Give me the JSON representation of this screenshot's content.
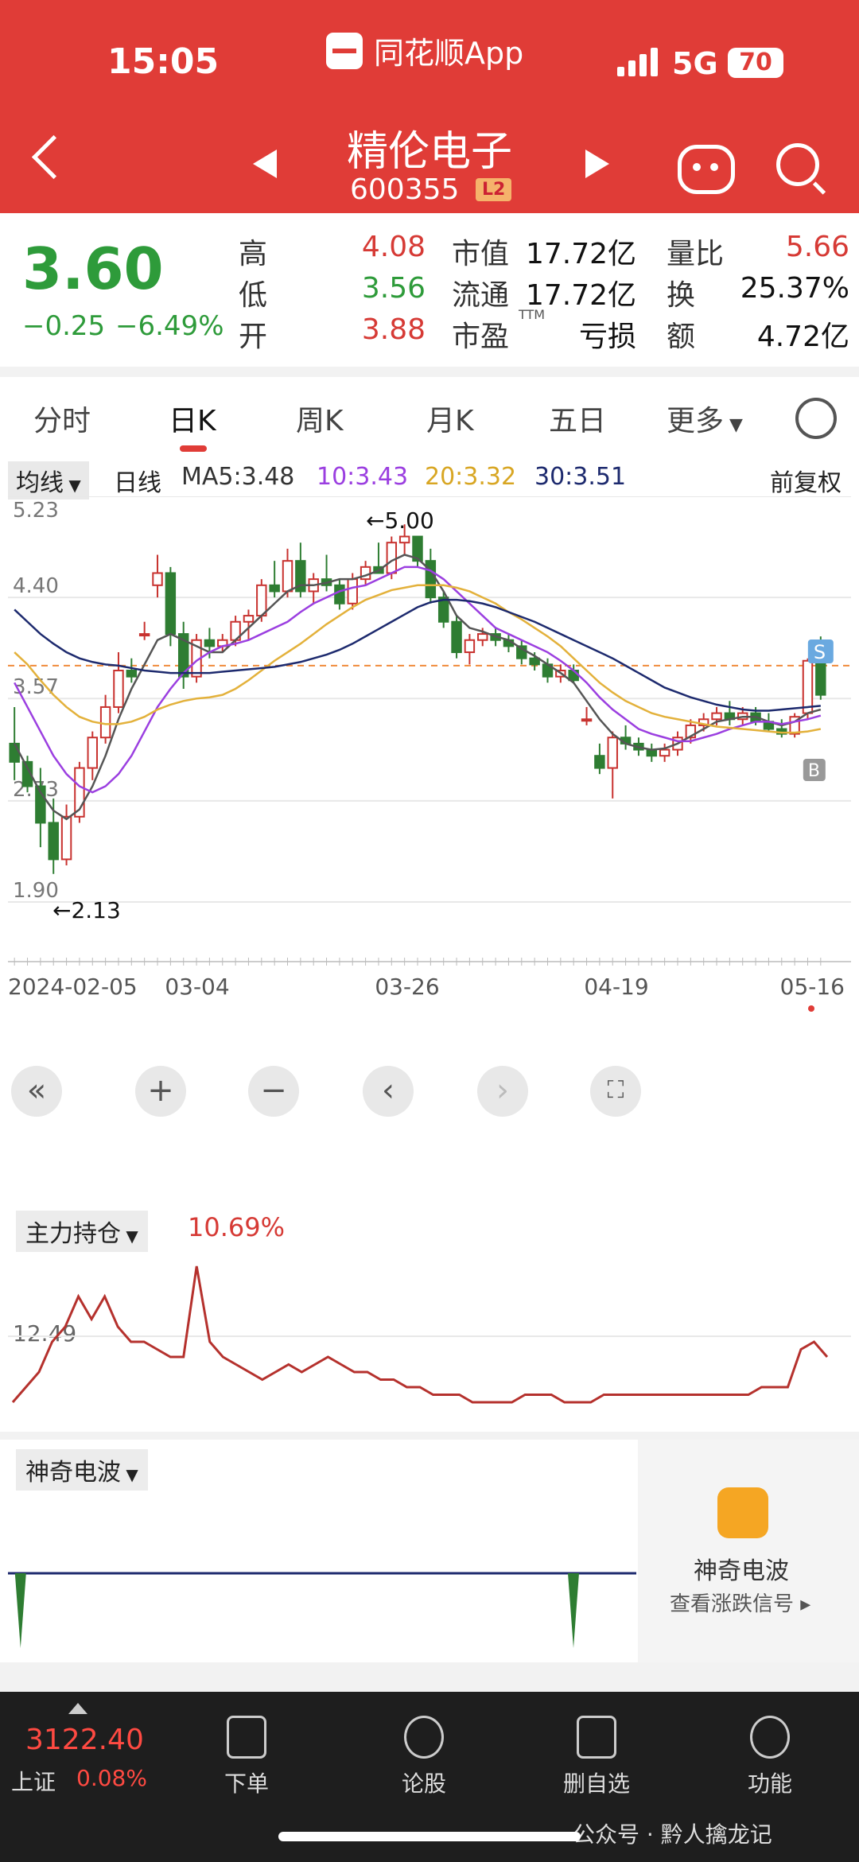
{
  "status_bar": {
    "time": "15:05",
    "app_name": "同花顺App",
    "network": "5G",
    "battery": "70"
  },
  "header": {
    "stock_name": "精伦电子",
    "stock_code": "600355",
    "level_badge": "L2"
  },
  "quote": {
    "price": "3.60",
    "change": "−0.25",
    "change_pct": "−6.49%",
    "rows": [
      {
        "l1": "高",
        "v1": "4.08",
        "l2": "市值",
        "v2": "17.72亿",
        "l3": "量比",
        "v3": "5.66"
      },
      {
        "l1": "低",
        "v1": "3.56",
        "l2": "流通",
        "v2": "17.72亿",
        "l3": "换",
        "v3": "25.37%"
      },
      {
        "l1": "开",
        "v1": "3.88",
        "l2": "市盈",
        "v2": "亏损",
        "l3": "额",
        "v3": "4.72亿"
      }
    ],
    "ttm": "TTM"
  },
  "tabs": [
    "分时",
    "日K",
    "周K",
    "月K",
    "五日",
    "更多"
  ],
  "ma_bar": {
    "selector": "均线",
    "period": "日线",
    "ma5": "MA5:3.48",
    "ma10": "10:3.43",
    "ma20": "20:3.32",
    "ma30": "30:3.51",
    "adjust": "前复权"
  },
  "colors": {
    "up": "#c8322f",
    "down": "#2e7d32",
    "ma5": "#555555",
    "ma10": "#9b3fe0",
    "ma20": "#e3b13b",
    "ma30": "#1d2a6e",
    "accent": "#e03c37"
  },
  "chart_data": {
    "type": "candlestick",
    "y_ticks": [
      "5.23",
      "4.40",
      "3.57",
      "2.73",
      "1.90"
    ],
    "ylim": [
      1.9,
      5.23
    ],
    "x_ticks": [
      "2024-02-05",
      "03-04",
      "03-26",
      "04-19",
      "05-16"
    ],
    "annotations": {
      "high": "←5.00",
      "low": "←2.13",
      "sell_marker": "S",
      "buy_marker": "B"
    },
    "reference_price": 3.84,
    "candles": [
      [
        3.2,
        3.5,
        2.9,
        3.05
      ],
      [
        3.05,
        3.1,
        2.8,
        2.85
      ],
      [
        2.85,
        3.0,
        2.35,
        2.55
      ],
      [
        2.55,
        2.75,
        2.13,
        2.25
      ],
      [
        2.25,
        2.7,
        2.2,
        2.6
      ],
      [
        2.6,
        3.05,
        2.55,
        3.0
      ],
      [
        3.0,
        3.3,
        2.9,
        3.25
      ],
      [
        3.25,
        3.6,
        3.2,
        3.5
      ],
      [
        3.5,
        3.95,
        3.45,
        3.8
      ],
      [
        3.8,
        3.9,
        3.7,
        3.75
      ],
      [
        4.1,
        4.2,
        4.05,
        4.1
      ],
      [
        4.5,
        4.75,
        4.4,
        4.6
      ],
      [
        4.6,
        4.65,
        4.0,
        4.1
      ],
      [
        4.1,
        4.2,
        3.65,
        3.75
      ],
      [
        3.75,
        4.1,
        3.7,
        4.05
      ],
      [
        4.05,
        4.15,
        3.9,
        4.0
      ],
      [
        4.0,
        4.1,
        3.95,
        4.05
      ],
      [
        4.05,
        4.25,
        4.0,
        4.2
      ],
      [
        4.2,
        4.3,
        4.05,
        4.25
      ],
      [
        4.25,
        4.55,
        4.2,
        4.5
      ],
      [
        4.5,
        4.7,
        4.4,
        4.45
      ],
      [
        4.45,
        4.8,
        4.4,
        4.7
      ],
      [
        4.7,
        4.85,
        4.4,
        4.45
      ],
      [
        4.45,
        4.6,
        4.35,
        4.55
      ],
      [
        4.55,
        4.75,
        4.45,
        4.5
      ],
      [
        4.5,
        4.55,
        4.3,
        4.35
      ],
      [
        4.35,
        4.6,
        4.3,
        4.55
      ],
      [
        4.55,
        4.7,
        4.5,
        4.65
      ],
      [
        4.65,
        4.85,
        4.6,
        4.6
      ],
      [
        4.6,
        4.9,
        4.55,
        4.85
      ],
      [
        4.85,
        5.0,
        4.75,
        4.9
      ],
      [
        4.9,
        4.9,
        4.65,
        4.7
      ],
      [
        4.7,
        4.8,
        4.35,
        4.4
      ],
      [
        4.4,
        4.45,
        4.15,
        4.2
      ],
      [
        4.2,
        4.25,
        3.9,
        3.95
      ],
      [
        3.95,
        4.1,
        3.85,
        4.05
      ],
      [
        4.05,
        4.15,
        4.0,
        4.1
      ],
      [
        4.1,
        4.15,
        4.0,
        4.05
      ],
      [
        4.05,
        4.1,
        3.95,
        4.0
      ],
      [
        4.0,
        4.05,
        3.85,
        3.9
      ],
      [
        3.9,
        3.95,
        3.8,
        3.85
      ],
      [
        3.85,
        3.9,
        3.7,
        3.75
      ],
      [
        3.75,
        3.85,
        3.7,
        3.8
      ],
      [
        3.8,
        3.85,
        3.7,
        3.72
      ],
      [
        3.4,
        3.5,
        3.35,
        3.4
      ],
      [
        3.1,
        3.2,
        2.95,
        3.0
      ],
      [
        3.0,
        3.3,
        2.75,
        3.25
      ],
      [
        3.25,
        3.35,
        3.15,
        3.2
      ],
      [
        3.2,
        3.25,
        3.1,
        3.15
      ],
      [
        3.15,
        3.2,
        3.05,
        3.1
      ],
      [
        3.1,
        3.2,
        3.05,
        3.15
      ],
      [
        3.15,
        3.3,
        3.1,
        3.25
      ],
      [
        3.25,
        3.4,
        3.2,
        3.35
      ],
      [
        3.35,
        3.45,
        3.3,
        3.4
      ],
      [
        3.4,
        3.5,
        3.35,
        3.45
      ],
      [
        3.45,
        3.55,
        3.35,
        3.4
      ],
      [
        3.4,
        3.5,
        3.35,
        3.45
      ],
      [
        3.45,
        3.5,
        3.35,
        3.38
      ],
      [
        3.38,
        3.45,
        3.3,
        3.32
      ],
      [
        3.32,
        3.4,
        3.25,
        3.28
      ],
      [
        3.28,
        3.45,
        3.25,
        3.42
      ],
      [
        3.45,
        3.9,
        3.4,
        3.88
      ],
      [
        3.88,
        4.08,
        3.56,
        3.6
      ]
    ],
    "ma5": [
      3.2,
      3.0,
      2.8,
      2.65,
      2.58,
      2.66,
      2.85,
      3.1,
      3.4,
      3.65,
      3.85,
      4.05,
      4.1,
      4.05,
      4.0,
      3.95,
      3.95,
      4.05,
      4.15,
      4.25,
      4.35,
      4.45,
      4.5,
      4.5,
      4.52,
      4.55,
      4.55,
      4.58,
      4.62,
      4.7,
      4.75,
      4.72,
      4.62,
      4.45,
      4.25,
      4.15,
      4.12,
      4.08,
      4.05,
      3.98,
      3.92,
      3.85,
      3.78,
      3.7,
      3.55,
      3.4,
      3.28,
      3.2,
      3.17,
      3.15,
      3.16,
      3.2,
      3.26,
      3.32,
      3.38,
      3.4,
      3.42,
      3.42,
      3.38,
      3.35,
      3.38,
      3.45,
      3.48
    ],
    "ma10": [
      3.7,
      3.5,
      3.3,
      3.1,
      2.95,
      2.85,
      2.8,
      2.85,
      2.95,
      3.1,
      3.3,
      3.5,
      3.65,
      3.78,
      3.88,
      3.95,
      4.0,
      4.02,
      4.05,
      4.1,
      4.15,
      4.2,
      4.28,
      4.35,
      4.4,
      4.45,
      4.48,
      4.5,
      4.55,
      4.6,
      4.65,
      4.65,
      4.62,
      4.55,
      4.45,
      4.35,
      4.25,
      4.15,
      4.1,
      4.05,
      4.0,
      3.95,
      3.88,
      3.8,
      3.7,
      3.58,
      3.48,
      3.4,
      3.32,
      3.28,
      3.25,
      3.22,
      3.22,
      3.25,
      3.28,
      3.32,
      3.35,
      3.38,
      3.38,
      3.36,
      3.38,
      3.4,
      3.43
    ],
    "ma20": [
      3.95,
      3.85,
      3.72,
      3.6,
      3.5,
      3.42,
      3.38,
      3.36,
      3.36,
      3.38,
      3.42,
      3.48,
      3.52,
      3.55,
      3.57,
      3.58,
      3.6,
      3.65,
      3.72,
      3.8,
      3.88,
      3.95,
      4.02,
      4.1,
      4.18,
      4.25,
      4.32,
      4.38,
      4.42,
      4.46,
      4.48,
      4.5,
      4.5,
      4.5,
      4.48,
      4.45,
      4.4,
      4.35,
      4.28,
      4.22,
      4.15,
      4.08,
      4.0,
      3.9,
      3.8,
      3.7,
      3.62,
      3.55,
      3.5,
      3.45,
      3.42,
      3.4,
      3.38,
      3.36,
      3.34,
      3.33,
      3.32,
      3.31,
      3.3,
      3.29,
      3.29,
      3.3,
      3.32
    ],
    "ma30": [
      4.3,
      4.2,
      4.1,
      4.02,
      3.95,
      3.9,
      3.87,
      3.85,
      3.84,
      3.82,
      3.8,
      3.79,
      3.78,
      3.78,
      3.78,
      3.78,
      3.79,
      3.8,
      3.81,
      3.82,
      3.83,
      3.85,
      3.87,
      3.9,
      3.93,
      3.97,
      4.02,
      4.08,
      4.14,
      4.2,
      4.26,
      4.32,
      4.36,
      4.38,
      4.38,
      4.37,
      4.35,
      4.32,
      4.28,
      4.24,
      4.2,
      4.15,
      4.1,
      4.05,
      4.0,
      3.95,
      3.9,
      3.84,
      3.78,
      3.72,
      3.66,
      3.62,
      3.58,
      3.55,
      3.52,
      3.5,
      3.48,
      3.47,
      3.47,
      3.48,
      3.49,
      3.5,
      3.51
    ]
  },
  "indicator1": {
    "selector": "主力持仓",
    "value": "10.69%",
    "y_tick": "12.49",
    "values": [
      2,
      4,
      6,
      10,
      12,
      16,
      13,
      16,
      12,
      10,
      10,
      9,
      8,
      8,
      20,
      10,
      8,
      7,
      6,
      5,
      6,
      7,
      6,
      7,
      8,
      7,
      6,
      6,
      5,
      5,
      4,
      4,
      3,
      3,
      3,
      2,
      2,
      2,
      2,
      3,
      3,
      3,
      2,
      2,
      2,
      3,
      3,
      3,
      3,
      3,
      3,
      3,
      3,
      3,
      3,
      3,
      3,
      4,
      4,
      4,
      9,
      10,
      8
    ]
  },
  "indicator2": {
    "selector": "神奇电波",
    "promo_title": "神奇电波",
    "promo_sub": "查看涨跌信号",
    "spikes": [
      0.02,
      0.9
    ]
  },
  "bottom": {
    "index_value": "3122.40",
    "index_name": "上证",
    "index_pct": "0.08%",
    "nav": [
      "下单",
      "论股",
      "删自选",
      "功能"
    ]
  },
  "watermark": "公众号 · 黔人擒龙记"
}
